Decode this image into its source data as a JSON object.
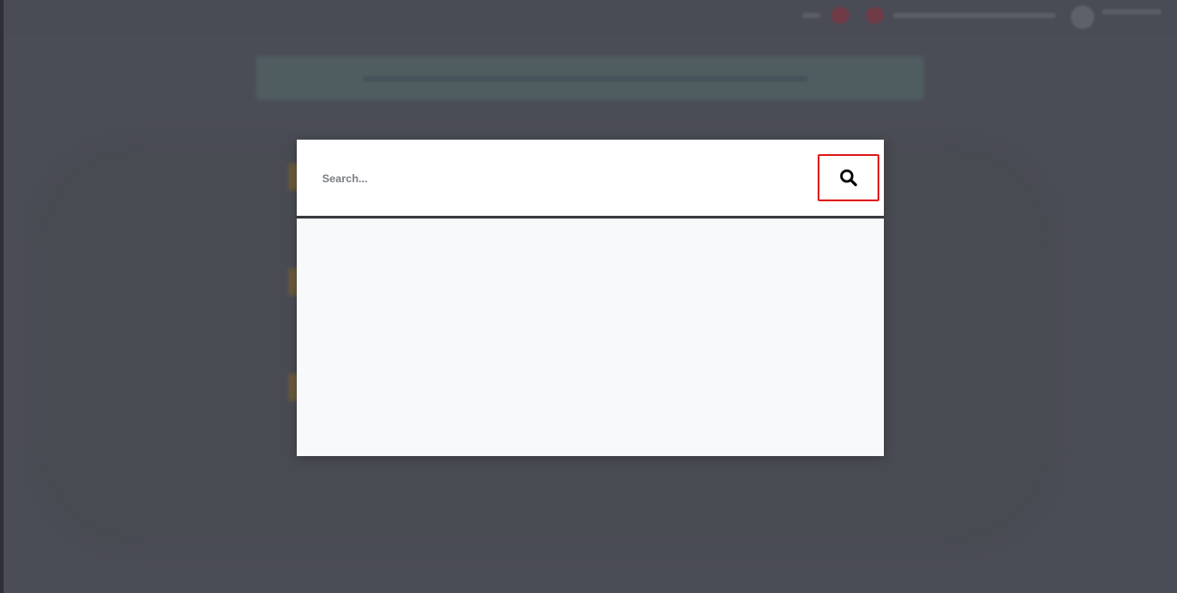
{
  "search": {
    "placeholder": "Search...",
    "value": "",
    "button_icon": "search-icon"
  },
  "colors": {
    "overlay": "#4b4d56",
    "modal_background": "#f8f9fb",
    "search_bar_background": "#ffffff",
    "divider": "#3a3b40",
    "highlight_border": "#e11b1b",
    "placeholder_text": "#7a7d85"
  }
}
